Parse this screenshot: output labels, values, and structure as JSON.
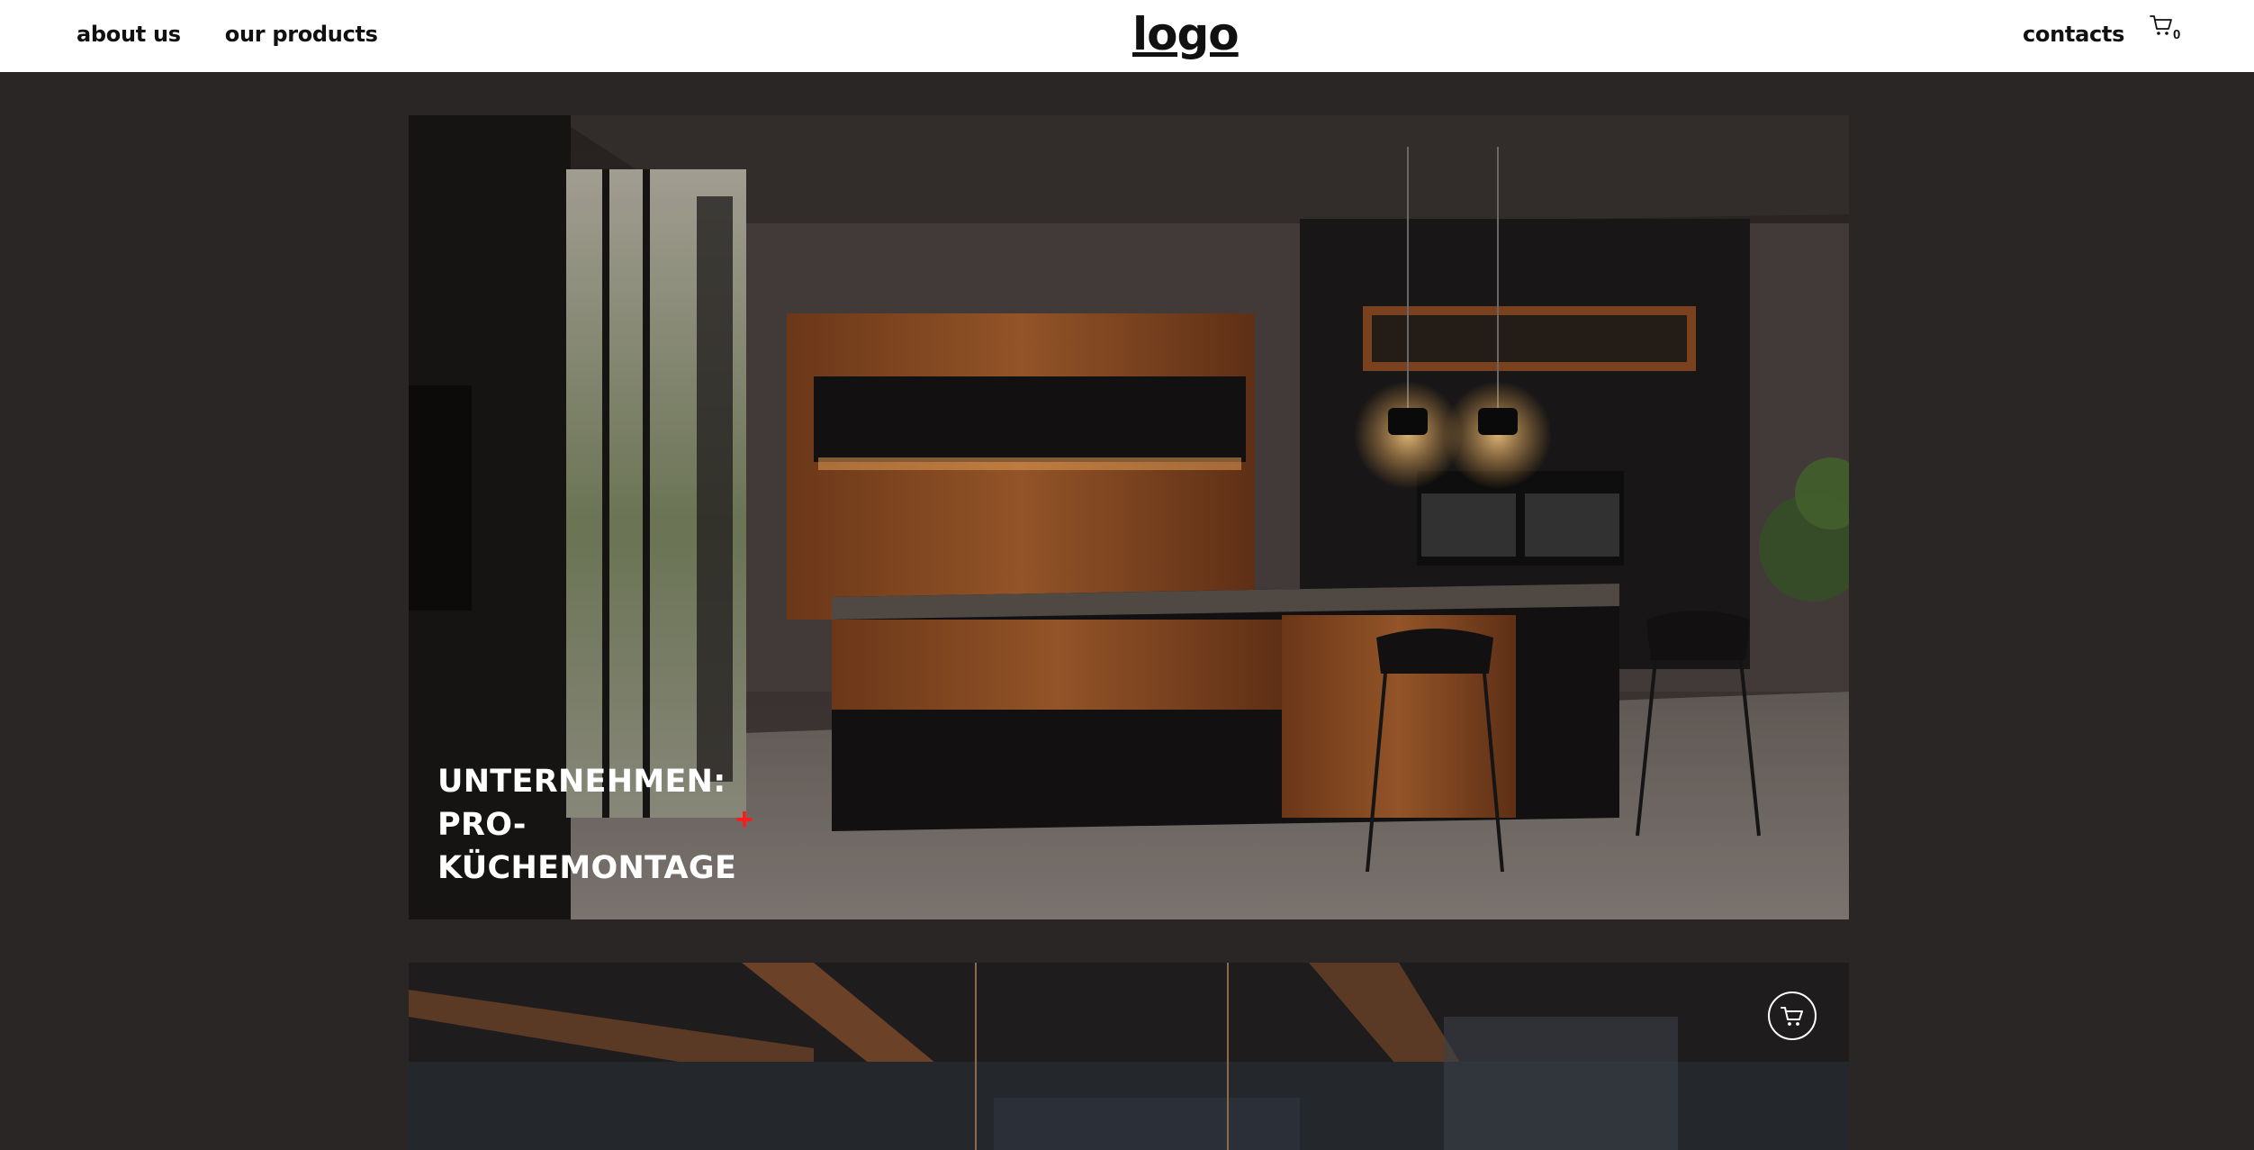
{
  "header": {
    "nav_left": [
      {
        "label": "about us"
      },
      {
        "label": "our products"
      }
    ],
    "logo_text": "logo",
    "nav_right": {
      "label": "contacts"
    },
    "cart": {
      "icon": "cart-icon",
      "count": "0"
    }
  },
  "hero": {
    "title_lines": [
      "UNTERNEHMEN:",
      "PRO-",
      "KÜCHEMONTAGE"
    ],
    "plus_symbol": "+",
    "accent_color": "#ff1a1a"
  },
  "card2": {
    "cart_button_icon": "cart-icon"
  },
  "colors": {
    "page_background": "#2a2625",
    "header_background": "#ffffff"
  }
}
